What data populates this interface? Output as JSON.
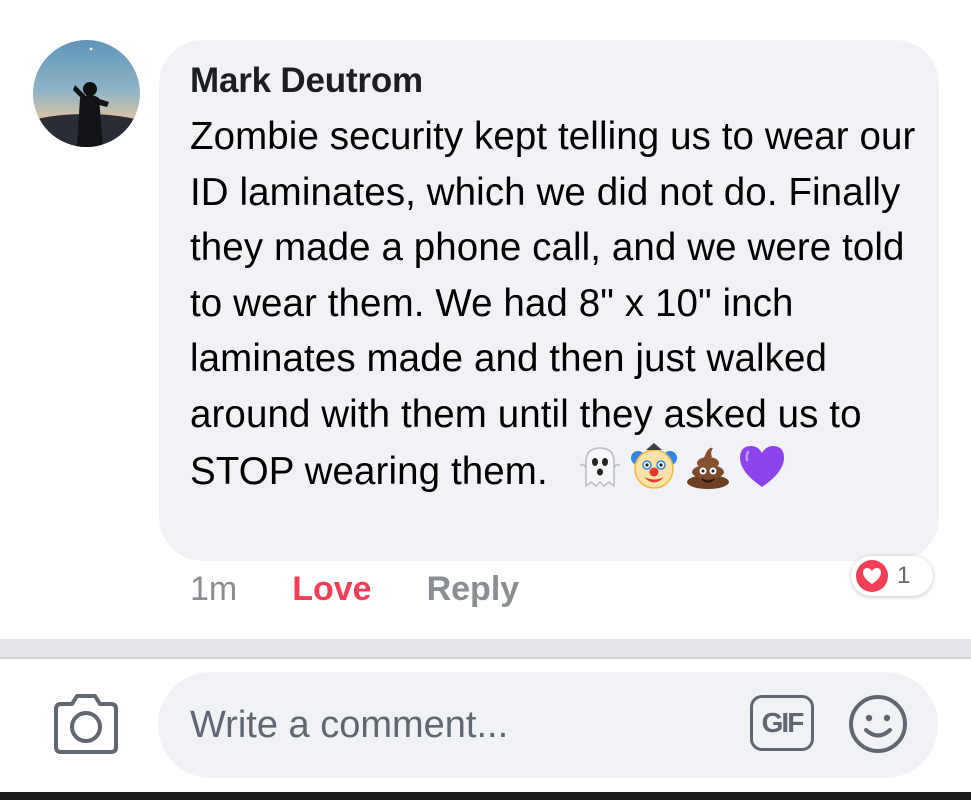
{
  "comment": {
    "author": "Mark Deutrom",
    "text": "Zombie security kept telling us to wear our ID laminates, which we did not do. Finally they made a phone call, and we were told to wear them. We had 8\" x 10\" inch laminates made and then just walked around with them until they asked us to STOP wearing them.",
    "emojis": [
      "ghost-emoji",
      "clown-emoji",
      "poop-emoji",
      "purple-heart-emoji"
    ]
  },
  "actions": {
    "time": "1m",
    "love_label": "Love",
    "reply_label": "Reply"
  },
  "reaction": {
    "icon": "heart-reaction-icon",
    "count": "1",
    "color": "#f33e58"
  },
  "composer": {
    "placeholder": "Write a comment...",
    "gif_label": "GIF",
    "camera_icon": "camera-icon",
    "emoji_icon": "smiley-icon"
  },
  "colors": {
    "bubble": "#f0f2f5",
    "love": "#f33e58",
    "muted": "#8a8d91"
  }
}
